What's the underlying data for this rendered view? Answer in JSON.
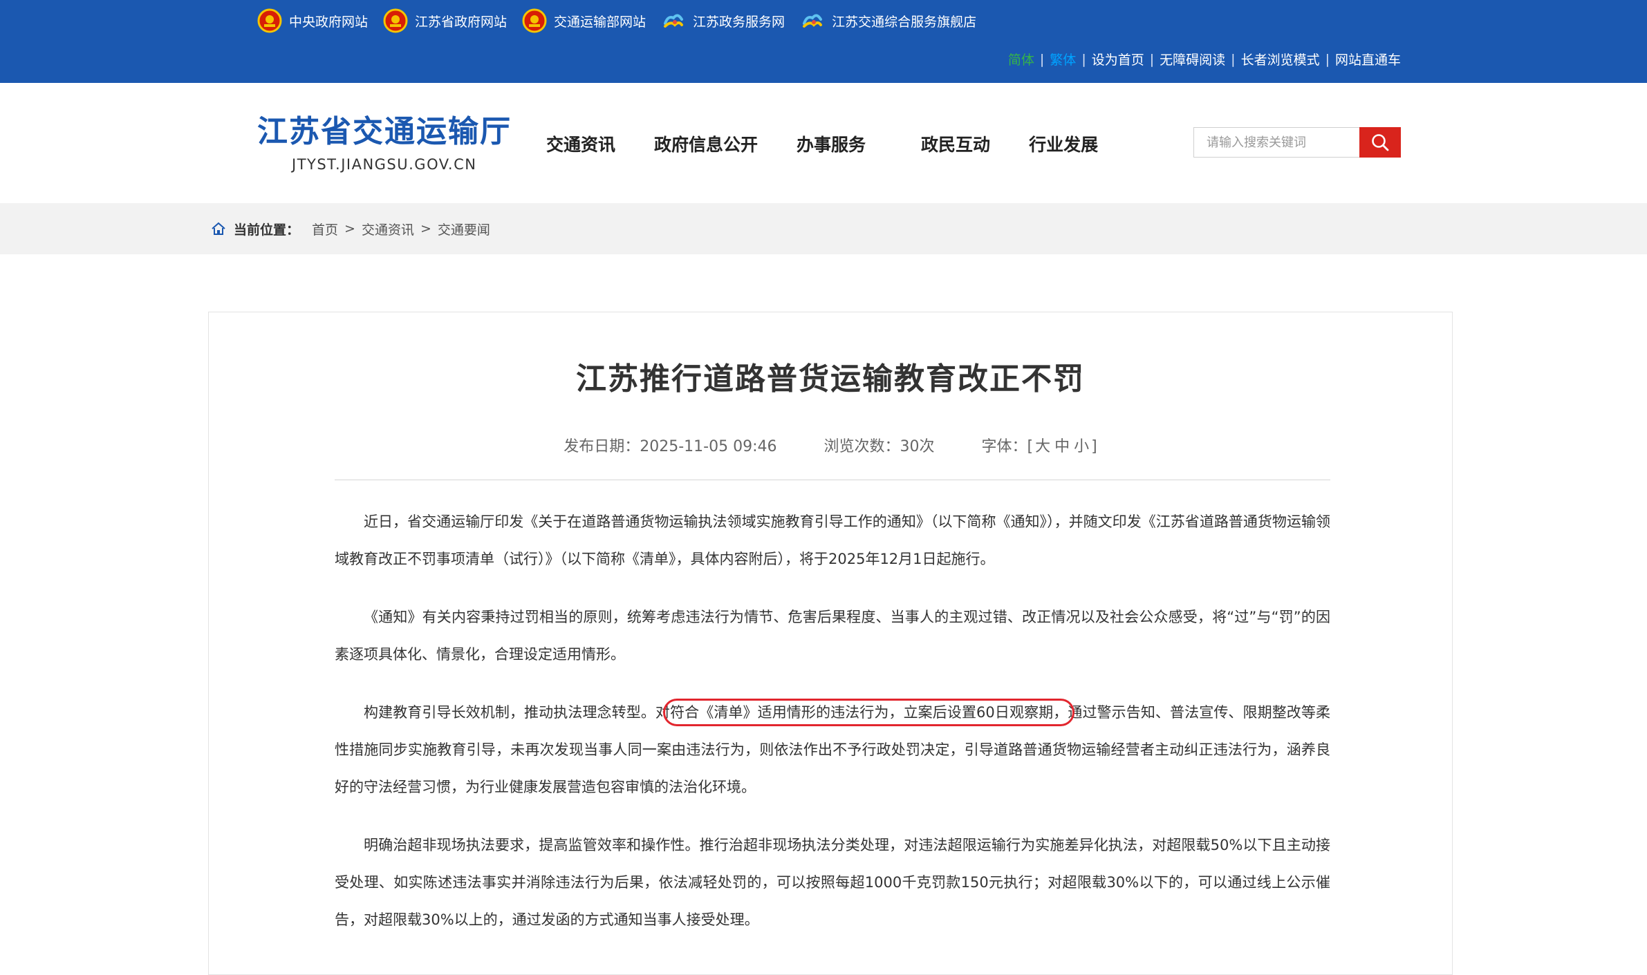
{
  "topbar": {
    "gov_links": [
      {
        "label": "中央政府网站",
        "icon": "national-emblem-icon"
      },
      {
        "label": "江苏省政府网站",
        "icon": "national-emblem-icon"
      },
      {
        "label": "交通运输部网站",
        "icon": "national-emblem-icon"
      },
      {
        "label": "江苏政务服务网",
        "icon": "service-logo-icon"
      },
      {
        "label": "江苏交通综合服务旗舰店",
        "icon": "service-logo-icon"
      }
    ],
    "util_links": [
      "简体",
      "繁体",
      "设为首页",
      "无障碍阅读",
      "长者浏览模式",
      "网站直通车"
    ],
    "separator": "|"
  },
  "header": {
    "logo_cn": "江苏省交通运输厅",
    "logo_en": "JTYST.JIANGSU.GOV.CN",
    "nav": [
      "交通资讯",
      "政府信息公开",
      "办事服务",
      "政民互动",
      "行业发展"
    ],
    "search_placeholder": "请输入搜索关键词"
  },
  "breadcrumb": {
    "label": "当前位置：",
    "items": [
      "首页",
      "交通资讯",
      "交通要闻"
    ],
    "separator": ">"
  },
  "article": {
    "title": "江苏推行道路普货运输教育改正不罚",
    "date_label": "发布日期：",
    "date": "2025-11-05 09:46",
    "views_label": "浏览次数：",
    "views": "30次",
    "font_label": "字体：",
    "font_open": "[",
    "font_sizes": [
      "大",
      "中",
      "小"
    ],
    "font_close": "]",
    "p1": "近日，省交通运输厅印发《关于在道路普通货物运输执法领域实施教育引导工作的通知》（以下简称《通知》），并随文印发《江苏省道路普通货物运输领域教育改正不罚事项清单（试行）》（以下简称《清单》，具体内容附后），将于2025年12月1日起施行。",
    "p2": "《通知》有关内容秉持过罚相当的原则，统筹考虑违法行为情节、危害后果程度、当事人的主观过错、改正情况以及社会公众感受，将“过”与“罚”的因素逐项具体化、情景化，合理设定适用情形。",
    "p3_pre": "构建教育引导长效机制，推动执法理念转型。对",
    "p3_highlight": "符合《清单》适用情形的违法行为，立案后设置60日观察期，",
    "p3_post": "通过警示告知、普法宣传、限期整改等柔性措施同步实施教育引导，未再次发现当事人同一案由违法行为，则依法作出不予行政处罚决定，引导道路普通货物运输经营者主动纠正违法行为，涵养良好的守法经营习惯，为行业健康发展营造包容审慎的法治化环境。",
    "p4": "明确治超非现场执法要求，提高监管效率和操作性。推行治超非现场执法分类处理，对违法超限运输行为实施差异化执法，对超限载50%以下且主动接受处理、如实陈述违法事实并消除违法行为后果，依法减轻处罚的，可以按照每超1000千克罚款150元执行；对超限载30%以下的，可以通过线上公示催告，对超限载30%以上的，通过发函的方式通知当事人接受处理。"
  },
  "colors": {
    "topbar": "#1b58b0",
    "logo": "#1b58b0",
    "search_button": "#d9241c",
    "highlight_ring": "#e2262e",
    "simplified_active": "#35b34a",
    "traditional_link": "#00a2ff"
  }
}
